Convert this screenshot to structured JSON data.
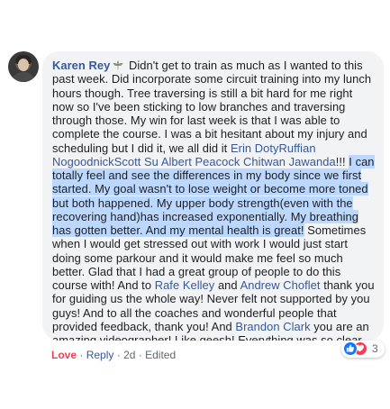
{
  "comment": {
    "author": "Karen Rey",
    "segments": [
      {
        "type": "text",
        "text": " Didn't get to train as much as I wanted to this past week. Did incorporate some circuit training into my lunch hours though. Tree traversing is still a bit hard for me right now so I've been sticking to low branches and traversing through those. My win for last week is that I was able to complete the course. I was a bit hesitant about my injury and scheduling but I did it, we all did it "
      },
      {
        "type": "mention",
        "text": "Erin Doty"
      },
      {
        "type": "mention",
        "text": "Ruffian Nogoodnick"
      },
      {
        "type": "mention",
        "text": "Scott Su"
      },
      {
        "type": "text",
        "text": " "
      },
      {
        "type": "mention",
        "text": "Albert Peacock"
      },
      {
        "type": "text",
        "text": " "
      },
      {
        "type": "mention",
        "text": "Chitwan Jawanda"
      },
      {
        "type": "text",
        "text": "!!! "
      },
      {
        "type": "highlight",
        "text": "I can totally feel and see the differences in my body since we first started. My goal wasn't to lose weight or become more toned but both happened. My upper body strength(even with the recovering hand)has increased exponentially. My breathing has gotten better. And my mental health is great!"
      },
      {
        "type": "text",
        "text": " Sometimes when I would get stressed out with work I would just start doing some parkour and it would make me feel so much better. Glad that I had a great group of people to do this course with! And to "
      },
      {
        "type": "mention",
        "text": "Rafe Kelley"
      },
      {
        "type": "text",
        "text": " and "
      },
      {
        "type": "mention",
        "text": "Andrew Choflet"
      },
      {
        "type": "text",
        "text": " thank you for guiding us the whole way! Never felt not supported by you guys! And to all the coaches and wonderful people that provided feedback, thank you! And "
      },
      {
        "type": "mention",
        "text": "Brandon Clark"
      },
      {
        "type": "text",
        "text": " you are an amazing videographer! Like geesh! Everything was so clear and beautiful! Very grateful for all of you! "
      },
      {
        "type": "emoji",
        "text": "❤️",
        "icon": "red-heart-icon"
      }
    ]
  },
  "actions": {
    "love_label": "Love",
    "separator": "·",
    "reply_label": "Reply",
    "time": "2d",
    "edited_label": "Edited"
  },
  "reactions": {
    "count": "3",
    "icons": [
      "like-icon",
      "love-icon"
    ]
  },
  "colors": {
    "bubble_bg": "#f2f3f5",
    "link": "#385898",
    "highlight": "#bcd8ff",
    "love": "#f33e58",
    "like": "#1877f2",
    "meta": "#606770"
  }
}
